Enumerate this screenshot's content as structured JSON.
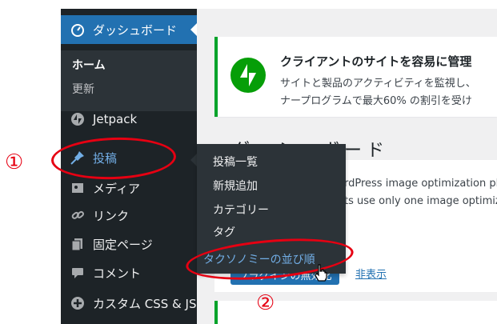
{
  "sidebar": {
    "dashboard_label": "ダッシュボード",
    "home_label": "ホーム",
    "updates_label": "更新",
    "jetpack_label": "Jetpack",
    "posts_label": "投稿",
    "media_label": "メディア",
    "links_label": "リンク",
    "pages_label": "固定ページ",
    "comments_label": "コメント",
    "custom_css_label": "カスタム CSS & JS"
  },
  "flyout": {
    "all_posts": "投稿一覧",
    "add_new": "新規追加",
    "categories": "カテゴリー",
    "tags": "タグ",
    "taxonomy_order": "タクソノミーの並び順"
  },
  "notice": {
    "title": "クライアントのサイトを容易に管理",
    "line1": "サイトと製品のアクティビティを監視し、",
    "line2": "ナープログラムで最大60% の割引を受け"
  },
  "main": {
    "page_title": "ダッシュボード",
    "line1": "rdPress image optimization plugi",
    "line2": "ts use only one image optimizer",
    "button_label": "プラグインの無効化",
    "hide_link": "非表示"
  },
  "annotations": {
    "step1": "①",
    "step2": "②"
  },
  "colors": {
    "sidebar_bg": "#1d2327",
    "accent": "#2271b1",
    "annotation_red": "#e60012",
    "jetpack_green": "#069e08"
  }
}
